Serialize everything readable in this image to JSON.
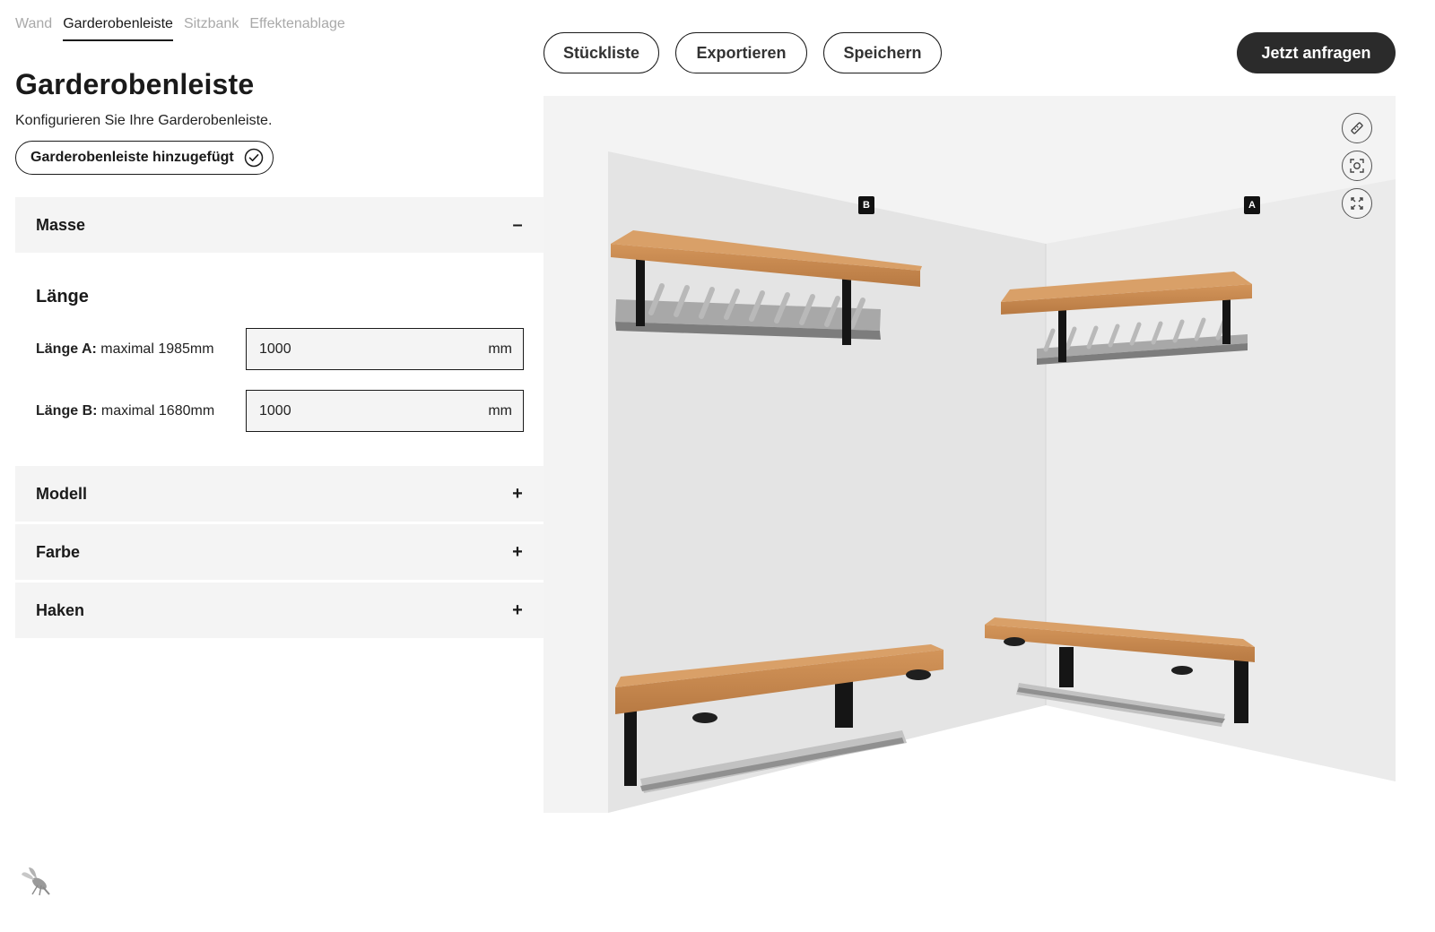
{
  "tabs": [
    {
      "label": "Wand",
      "active": false
    },
    {
      "label": "Garderobenleiste",
      "active": true
    },
    {
      "label": "Sitzbank",
      "active": false
    },
    {
      "label": "Effektenablage",
      "active": false
    }
  ],
  "page_title": "Garderobenleiste",
  "subtitle": "Konfigurieren Sie Ihre Garderobenleiste.",
  "added_badge": {
    "label": "Garderobenleiste hinzugefügt",
    "icon": "check-circle-icon"
  },
  "sections": {
    "masse": {
      "title": "Masse",
      "sign": "–",
      "expanded": true,
      "sub_title": "Länge",
      "fields": [
        {
          "label_bold": "Länge A:",
          "label_rest": " maximal 1985mm",
          "value": "1000",
          "unit": "mm"
        },
        {
          "label_bold": "Länge B:",
          "label_rest": " maximal 1680mm",
          "value": "1000",
          "unit": "mm"
        }
      ]
    },
    "modell": {
      "title": "Modell",
      "sign": "+"
    },
    "farbe": {
      "title": "Farbe",
      "sign": "+"
    },
    "haken": {
      "title": "Haken",
      "sign": "+"
    }
  },
  "toolbar": {
    "stueckliste": "Stückliste",
    "exportieren": "Exportieren",
    "speichern": "Speichern",
    "cta": "Jetzt anfragen"
  },
  "viewport": {
    "wall_labels": {
      "b": "B",
      "a": "A"
    },
    "tools": [
      "ruler-icon",
      "center-view-icon",
      "fullscreen-icon"
    ]
  },
  "colors": {
    "accent_dark": "#2b2b2b",
    "panel_bg": "#f4f4f4",
    "wood": "#c98a4f",
    "metal_black": "#151515",
    "steel": "#a8a8a8"
  }
}
